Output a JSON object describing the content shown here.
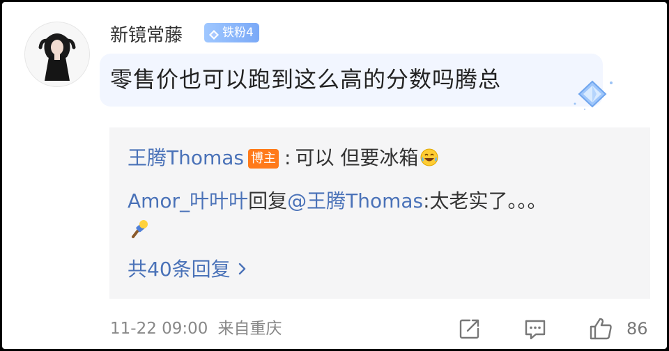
{
  "comment": {
    "username": "新镜常藤",
    "fan_badge": "铁粉4",
    "text": "零售价也可以跑到这么高的分数吗腾总",
    "time": "11-22 09:00",
    "location": "来自重庆",
    "like_count": "86"
  },
  "replies": {
    "items": [
      {
        "author": "王腾Thomas",
        "author_badge": "博主",
        "separator": ":",
        "text": "可以 但要冰箱"
      },
      {
        "author": "Amor_叶叶叶",
        "action": "回复",
        "mention": "@王腾Thomas",
        "separator": ":",
        "text": "太老实了。。。"
      }
    ],
    "more_label": "共40条回复"
  },
  "icons": {
    "fan_badge": "diamond-icon",
    "laugh": "laughing-tears-emoji-icon",
    "pin": "pushpin-emoji-icon",
    "more": "chevron-right-icon",
    "share": "share-icon",
    "comment": "comment-icon",
    "like": "thumbs-up-icon"
  },
  "colors": {
    "link_blue": "#4a72b8",
    "host_badge": "#ff7a1a",
    "fan_badge": "#7aa9f7",
    "bubble": "#f2f6ff"
  }
}
